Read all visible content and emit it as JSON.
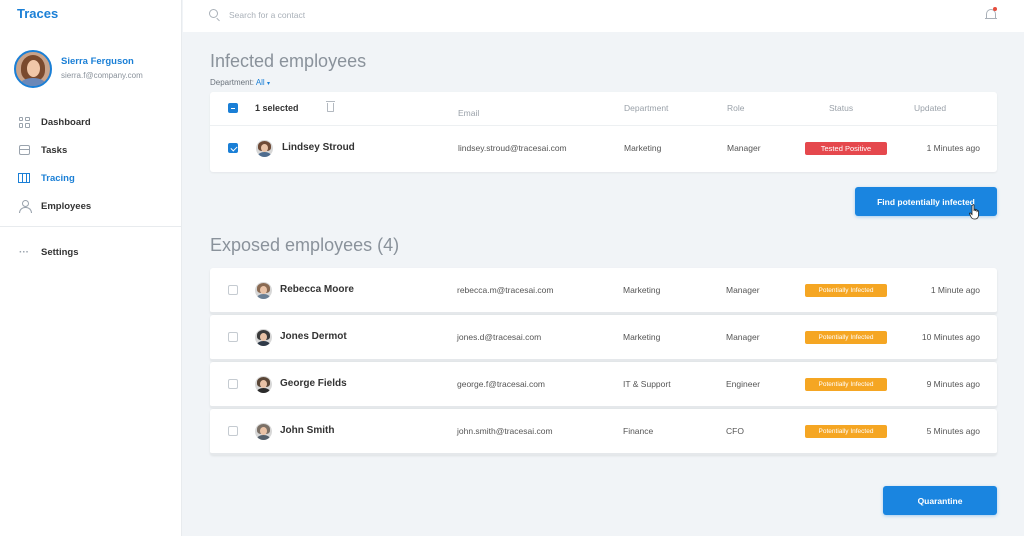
{
  "app": {
    "title": "Traces"
  },
  "user": {
    "name": "Sierra Ferguson",
    "email": "sierra.f@company.com"
  },
  "nav": {
    "items": [
      {
        "label": "Dashboard",
        "icon": "dashboard-icon",
        "active": false
      },
      {
        "label": "Tasks",
        "icon": "tasks-icon",
        "active": false
      },
      {
        "label": "Tracing",
        "icon": "tracing-icon",
        "active": true
      },
      {
        "label": "Employees",
        "icon": "employees-icon",
        "active": false
      }
    ],
    "settings_label": "Settings"
  },
  "search": {
    "placeholder": "Search for a contact"
  },
  "infected": {
    "title": "Infected employees",
    "department_label": "Department:",
    "department_value": "All",
    "selected_text": "1 selected",
    "columns": {
      "email": "Email",
      "department": "Department",
      "role": "Role",
      "status": "Status",
      "updated": "Updated"
    },
    "rows": [
      {
        "name": "Lindsey Stroud",
        "email": "lindsey.stroud@tracesai.com",
        "department": "Marketing",
        "role": "Manager",
        "status": "Tested Positive",
        "updated": "1 Minutes ago",
        "checked": true
      }
    ],
    "action_label": "Find potentially infected"
  },
  "exposed": {
    "title": "Exposed employees (4)",
    "rows": [
      {
        "name": "Rebecca Moore",
        "email": "rebecca.m@tracesai.com",
        "department": "Marketing",
        "role": "Manager",
        "status": "Potentially Infected",
        "updated": "1 Minute ago"
      },
      {
        "name": "Jones Dermot",
        "email": "jones.d@tracesai.com",
        "department": "Marketing",
        "role": "Manager",
        "status": "Potentially Infected",
        "updated": "10 Minutes ago"
      },
      {
        "name": "George Fields",
        "email": "george.f@tracesai.com",
        "department": "IT & Support",
        "role": "Engineer",
        "status": "Potentially Infected",
        "updated": "9 Minutes ago"
      },
      {
        "name": "John Smith",
        "email": "john.smith@tracesai.com",
        "department": "Finance",
        "role": "CFO",
        "status": "Potentially Infected",
        "updated": "5 Minutes ago"
      }
    ],
    "action_label": "Quarantine"
  },
  "colors": {
    "accent": "#1a85e0",
    "positive": "#e5484d",
    "potential": "#f5a623"
  }
}
